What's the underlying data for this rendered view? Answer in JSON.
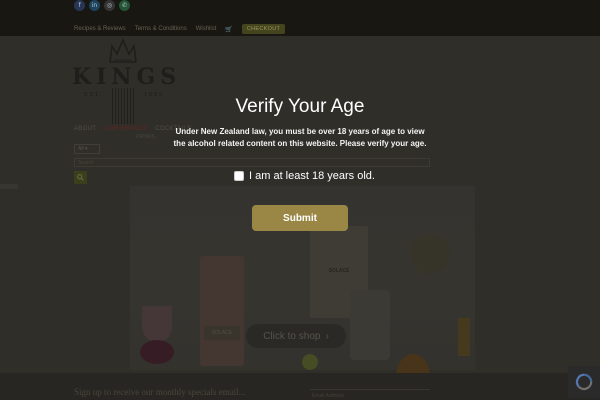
{
  "topbar": {
    "social": [
      {
        "icon": "facebook-icon",
        "glyph": "f"
      },
      {
        "icon": "linkedin-icon",
        "glyph": "in"
      },
      {
        "icon": "instagram-icon",
        "glyph": "◎"
      },
      {
        "icon": "whatsapp-icon",
        "glyph": "✆"
      }
    ],
    "links": [
      "Recipes & Reviews",
      "Terms & Conditions",
      "Wishlist"
    ],
    "cart_glyph": "🛒",
    "checkout_label": "CHECKOUT"
  },
  "logo": {
    "word": "KINGS",
    "est_left": "EST.",
    "est_year": "1985"
  },
  "nav": {
    "about": "ABOUT",
    "brands": "OUR BRANDS",
    "cocktails": "COCKTAILS",
    "sub": "DRINKS"
  },
  "filter": {
    "selected": "All ▾"
  },
  "search": {
    "placeholder": "Search"
  },
  "hero": {
    "product_label": "SOLACE",
    "product_label_2": "SOLACE",
    "shop_label": "Click to shop",
    "shop_arrow": "›"
  },
  "newsletter": {
    "text": "Sign up to receive our monthly specials email...",
    "field_placeholder": "Email Address"
  },
  "modal": {
    "title": "Verify Your Age",
    "body": "Under New Zealand law, you must be over 18 years of age to view the alcohol related content on this website. Please verify your age.",
    "checkbox_label": "I am at least 18 years old.",
    "checkbox_checked": false,
    "submit_label": "Submit",
    "accent_color": "#9a8746"
  }
}
